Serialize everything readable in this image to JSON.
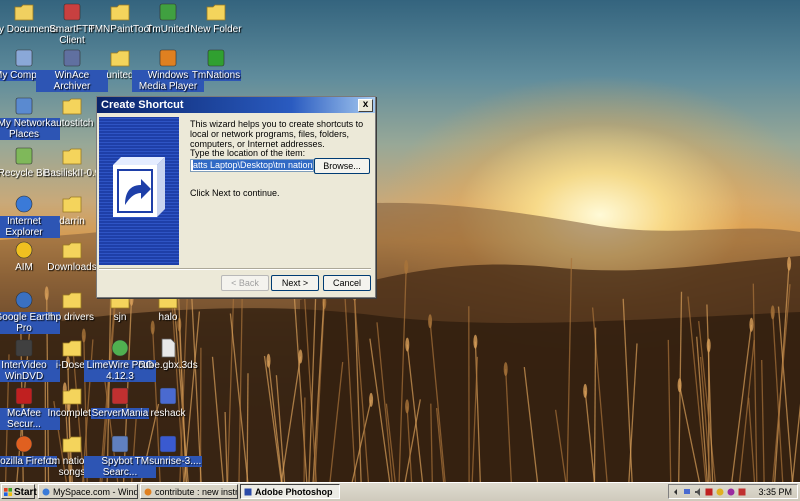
{
  "desktop": {
    "icons": [
      {
        "label": "My Documents",
        "icon": "documents-folder-icon",
        "color": "#f0d060"
      },
      {
        "label": "SmartFTP Client",
        "icon": "ftp-client-icon",
        "color": "#c84040"
      },
      {
        "label": "TMNPaintTool",
        "icon": "folder-icon",
        "color": "#f4d45c"
      },
      {
        "label": "TmUnited",
        "icon": "tmunited-icon",
        "color": "#40a040"
      },
      {
        "label": "New Folder",
        "icon": "folder-icon",
        "color": "#f4d45c"
      },
      {
        "label": "My Computer",
        "icon": "my-computer-icon",
        "color": "#8aa8d8"
      },
      {
        "label": "WinAce Archiver",
        "icon": "archiver-icon",
        "color": "#6070a0"
      },
      {
        "label": "united",
        "icon": "folder-icon",
        "color": "#f4d45c"
      },
      {
        "label": "Windows Media Player",
        "icon": "media-player-icon",
        "color": "#e08020"
      },
      {
        "label": "TmNations",
        "icon": "tmnations-icon",
        "color": "#30a030"
      },
      {
        "label": "My Network Places",
        "icon": "network-places-icon",
        "color": "#5a8ad0"
      },
      {
        "label": "autostitch",
        "icon": "folder-icon",
        "color": "#f4d45c"
      },
      {
        "label": "Recycle Bin",
        "icon": "recycle-bin-icon",
        "color": "#7fb85a"
      },
      {
        "label": "BasiliskII-0.9",
        "icon": "folder-icon",
        "color": "#f4d45c"
      },
      {
        "label": "Internet Explorer",
        "icon": "internet-explorer-icon",
        "color": "#3a7ad8"
      },
      {
        "label": "darrin",
        "icon": "folder-icon",
        "color": "#f4d45c"
      },
      {
        "label": "AIM",
        "icon": "aim-icon",
        "color": "#f0c020"
      },
      {
        "label": "Downloads",
        "icon": "folder-icon",
        "color": "#f4d45c"
      },
      {
        "label": "Google Earth Pro",
        "icon": "google-earth-icon",
        "color": "#3a70c0"
      },
      {
        "label": "hp drivers",
        "icon": "folder-icon",
        "color": "#f4d45c"
      },
      {
        "label": "sjn",
        "icon": "folder-icon",
        "color": "#f4d45c"
      },
      {
        "label": "halo",
        "icon": "folder-icon",
        "color": "#f4d45c"
      },
      {
        "label": "InterVideo WinDVD",
        "icon": "windvd-icon",
        "color": "#404040"
      },
      {
        "label": "i-Doser",
        "icon": "folder-icon",
        "color": "#f4d45c"
      },
      {
        "label": "LimeWire PRO 4.12.3",
        "icon": "limewire-icon",
        "color": "#50b050"
      },
      {
        "label": "cube.gbx.3ds",
        "icon": "file-icon",
        "color": "#e8e8e8"
      },
      {
        "label": "McAfee Secur...",
        "icon": "mcafee-icon",
        "color": "#c02020"
      },
      {
        "label": "Incomplete",
        "icon": "folder-icon",
        "color": "#f4d45c"
      },
      {
        "label": "ServerMania",
        "icon": "servermania-icon",
        "color": "#c03030"
      },
      {
        "label": "reshack",
        "icon": "reshack-icon",
        "color": "#4a6ad0"
      },
      {
        "label": "Mozilla Firefox",
        "icon": "firefox-icon",
        "color": "#e06020"
      },
      {
        "label": "tm nations songs",
        "icon": "folder-icon",
        "color": "#f4d45c"
      },
      {
        "label": "Spybot - Searc...",
        "icon": "spybot-icon",
        "color": "#6080c0"
      },
      {
        "label": "TMsunrise-3....",
        "icon": "tmsunrise-icon",
        "color": "#3a5ad0"
      }
    ]
  },
  "dialog": {
    "title": "Create Shortcut",
    "close_label": "x",
    "description": "This wizard helps you to create shortcuts to local or network programs, files, folders, computers, or Internet addresses.",
    "location_label": "Type the location of the item:",
    "location_value": "atts Laptop\\Desktop\\tm nations songs\"",
    "browse_label": "Browse...",
    "continue_text": "Click Next to continue.",
    "back_label": "< Back",
    "next_label": "Next >",
    "cancel_label": "Cancel"
  },
  "taskbar": {
    "start_label": "Start",
    "tasks": [
      {
        "label": "MySpace.com - Windows...",
        "icon": "browser-icon",
        "active": false
      },
      {
        "label": "contribute : new instruct...",
        "icon": "browser-icon",
        "active": false
      },
      {
        "label": "Adobe Photoshop",
        "icon": "photoshop-icon",
        "active": true
      }
    ],
    "clock": "3:35 PM"
  },
  "colors": {
    "titlebar": "#0a246a",
    "wizard_art": "#1e3fa8",
    "selection": "#316ac5"
  }
}
